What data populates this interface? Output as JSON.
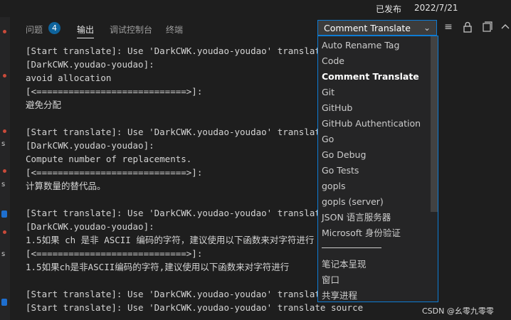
{
  "topbar": {
    "status": "已发布",
    "date": "2022/7/21"
  },
  "panel": {
    "tabs": [
      {
        "label": "问题"
      },
      {
        "label": "输出"
      },
      {
        "label": "调试控制台"
      },
      {
        "label": "终端"
      }
    ],
    "problems_count": "4",
    "channel_select": {
      "value": "Comment Translate",
      "chevron": "⌄"
    },
    "tools": [
      {
        "icon": "clear-output-icon",
        "glyph": "≡"
      },
      {
        "icon": "lock-icon",
        "glyph": "🔒"
      },
      {
        "icon": "open-file-icon",
        "glyph": "⧉"
      },
      {
        "icon": "maximize-icon",
        "glyph": "⌃"
      }
    ]
  },
  "output_lines": [
    "[Start translate]: Use 'DarkCWK.youdao-youdao' translate source",
    "[DarkCWK.youdao-youdao]:",
    "avoid allocation",
    "[<============================>]:",
    "避免分配",
    "",
    "[Start translate]: Use 'DarkCWK.youdao-youdao' translate source",
    "[DarkCWK.youdao-youdao]:",
    "Compute number of replacements.",
    "[<============================>]:",
    "计算数量的替代品。",
    "",
    "[Start translate]: Use 'DarkCWK.youdao-youdao' translate source",
    "[DarkCWK.youdao-youdao]:",
    "1.5如果 ch 是非 ASCII 编码的字符，建议使用以下函数来对字符进行",
    "[<============================>]:",
    "1.5如果ch是非ASCII编码的字符,建议使用以下函数来对字符进行",
    "",
    "[Start translate]: Use 'DarkCWK.youdao-youdao' translate source",
    "[Start translate]: Use 'DarkCWK.youdao-youdao' translate source"
  ],
  "dropdown": {
    "options": [
      "Auto Rename Tag",
      "Code",
      "Comment Translate",
      "Git",
      "GitHub",
      "GitHub Authentication",
      "Go",
      "Go Debug",
      "Go Tests",
      "gopls",
      "gopls (server)",
      "JSON 语言服务器",
      "Microsoft 身份验证"
    ],
    "selected": "Comment Translate",
    "options_after_divider": [
      "笔记本呈现",
      "窗口",
      "共享进程"
    ]
  },
  "watermark": "CSDN @幺零九零零",
  "left_strip_letters": [
    "s",
    "s",
    "s"
  ],
  "colors": {
    "accent": "#0e7cd4",
    "badge": "#0e639c",
    "background": "#1e1e1e"
  }
}
